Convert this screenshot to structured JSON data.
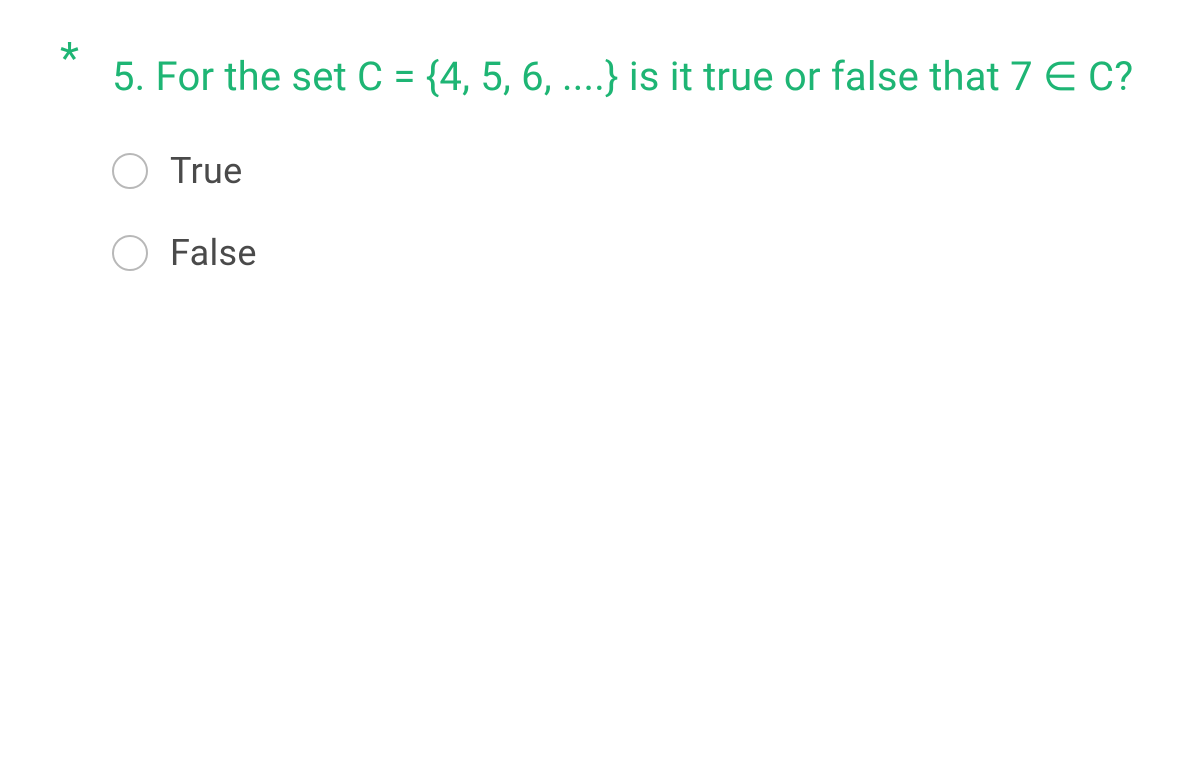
{
  "question": {
    "required_marker": "*",
    "text": "5. For the set C = {4, 5, 6, ....} is it true or false that 7 ∈ C?"
  },
  "options": [
    {
      "label": "True",
      "selected": false
    },
    {
      "label": "False",
      "selected": false
    }
  ]
}
